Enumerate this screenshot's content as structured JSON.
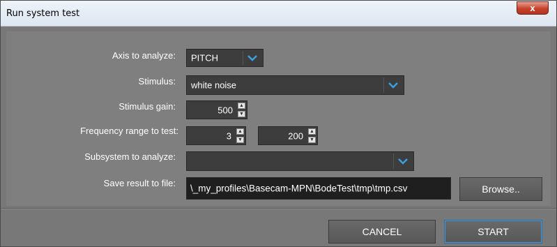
{
  "window": {
    "title": "Run system test",
    "close_glyph": "x"
  },
  "form": {
    "axis": {
      "label": "Axis to analyze:",
      "value": "PITCH"
    },
    "stimulus": {
      "label": "Stimulus:",
      "value": "white noise"
    },
    "gain": {
      "label": "Stimulus gain:",
      "value": "500"
    },
    "freq": {
      "label": "Frequency range to test:",
      "min": "3",
      "max": "200"
    },
    "subsystem": {
      "label": "Subsystem to analyze:",
      "value": ""
    },
    "save": {
      "label": "Save result to file:",
      "path": "\\_my_profiles\\Basecam-MPN\\BodeTest\\tmp\\tmp.csv",
      "browse_label": "Browse.."
    }
  },
  "footer": {
    "cancel_label": "CANCEL",
    "start_label": "START"
  },
  "colors": {
    "accent": "#2d7ab8",
    "panel": "#7f7f7f",
    "field": "#3d3d3d"
  },
  "icons": {
    "dropdown": "chevron-down-icon",
    "spinner": "spinner-arrows-icon",
    "close": "close-icon"
  }
}
